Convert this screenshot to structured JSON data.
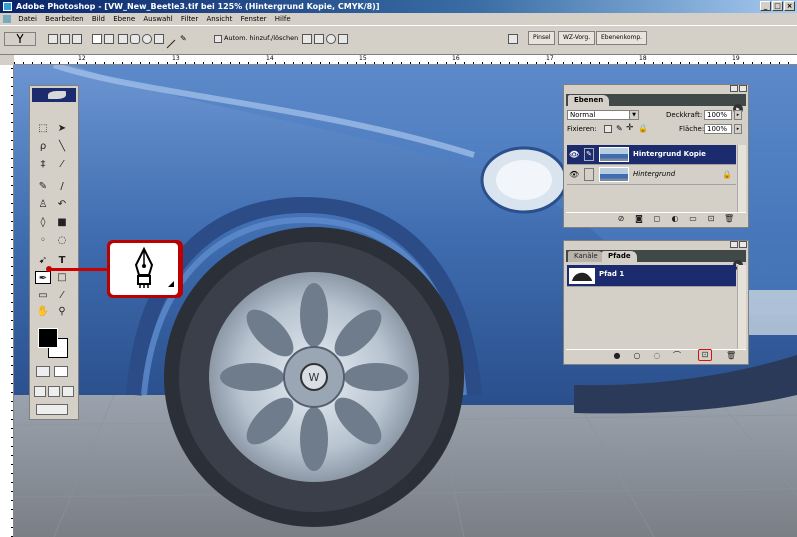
{
  "window": {
    "title": "Adobe Photoshop - [VW_New_Beetle3.tif bei 125% (Hintergrund Kopie, CMYK/8)]",
    "controls": [
      "_",
      "□",
      "×"
    ]
  },
  "menu": [
    "Datei",
    "Bearbeiten",
    "Bild",
    "Ebene",
    "Auswahl",
    "Filter",
    "Ansicht",
    "Fenster",
    "Hilfe"
  ],
  "options_bar": {
    "auto_add_delete_label": "Autom. hinzuf./löschen",
    "workspace_tabs": [
      "Pinsel",
      "WZ-Vorg.",
      "Ebenenkomp."
    ]
  },
  "ruler_top": {
    "numbers": [
      "12",
      "13",
      "14",
      "15",
      "16",
      "17",
      "18",
      "19"
    ]
  },
  "toolbox": {
    "tools": [
      "marquee",
      "move",
      "lasso",
      "magic-wand",
      "crop",
      "slice",
      "healing",
      "brush",
      "stamp",
      "history-brush",
      "eraser",
      "gradient",
      "blur",
      "dodge",
      "path-select",
      "type",
      "pen",
      "shape",
      "notes",
      "eyedropper",
      "hand",
      "zoom"
    ],
    "selected_tool": "pen",
    "foreground_color": "#000000",
    "background_color": "#ffffff"
  },
  "callout": {
    "icon": "pen-tool-icon",
    "border_color": "#bb0000"
  },
  "layers_panel": {
    "tab_label": "Ebenen",
    "menu_glyph": "▸",
    "blend_mode": "Normal",
    "opacity_label": "Deckkraft:",
    "opacity_value": "100%",
    "lock_label": "Fixieren:",
    "fill_label": "Fläche:",
    "fill_value": "100%",
    "layers": [
      {
        "name": "Hintergrund Kopie",
        "selected": true,
        "visible": true
      },
      {
        "name": "Hintergrund",
        "selected": false,
        "visible": true,
        "locked": true
      }
    ]
  },
  "paths_panel": {
    "tabs": [
      "Kanäle",
      "Pfade"
    ],
    "active_tab": "Pfade",
    "menu_glyph": "▸",
    "paths": [
      {
        "name": "Pfad 1",
        "selected": true
      }
    ],
    "highlight_color": "#d81010"
  },
  "colors": {
    "car_blue": "#3f6db0",
    "selection_navy": "#1c2b6e",
    "accent_red": "#cc0000"
  }
}
